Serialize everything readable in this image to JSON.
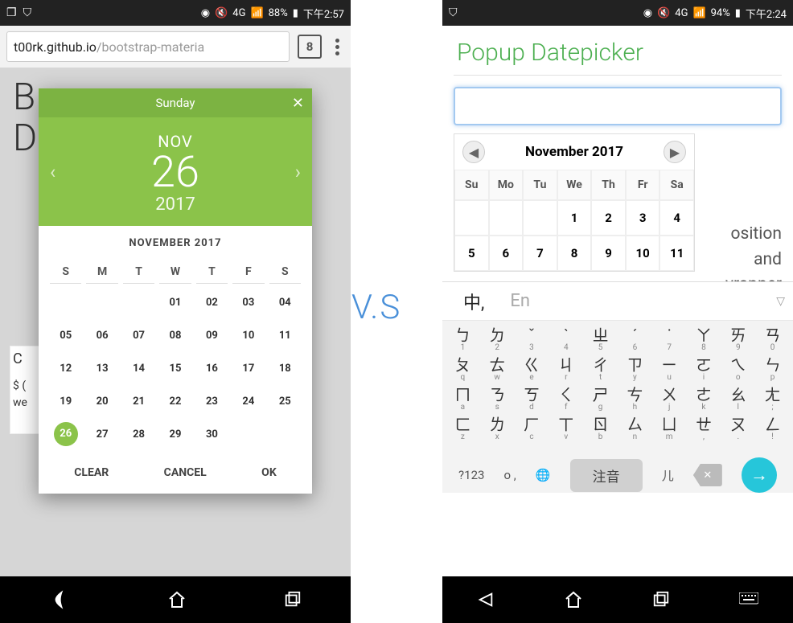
{
  "comparison_label": "V.S",
  "left": {
    "statusbar": {
      "battery": "88%",
      "time": "下午2:57",
      "net": "4G"
    },
    "url_dark": "t00rk.github.io",
    "url_light": "/bootstrap-materia",
    "tab_count": "8",
    "bg_B": "B",
    "bg_D": "D",
    "bg_card_c": "C",
    "bg_card_l1": "$ (",
    "bg_card_l2": "we",
    "dp": {
      "weekday": "Sunday",
      "month_abbr": "NOV",
      "day": "26",
      "year": "2017",
      "title": "NOVEMBER 2017",
      "dow": [
        "S",
        "M",
        "T",
        "W",
        "T",
        "F",
        "S"
      ],
      "weeks": [
        [
          "",
          "",
          "",
          "",
          "01",
          "02",
          "03",
          "04"
        ],
        [
          "05",
          "06",
          "07",
          "08",
          "09",
          "10",
          "11"
        ],
        [
          "12",
          "13",
          "14",
          "15",
          "16",
          "17",
          "18"
        ],
        [
          "19",
          "20",
          "21",
          "22",
          "23",
          "24",
          "25"
        ],
        [
          "26",
          "27",
          "28",
          "29",
          "30",
          "",
          ""
        ]
      ],
      "selected": "26",
      "clear": "CLEAR",
      "cancel": "CANCEL",
      "ok": "OK"
    }
  },
  "right": {
    "statusbar": {
      "battery": "94%",
      "time": "下午2:24",
      "net": "4G"
    },
    "title": "Popup Datepicker",
    "cal": {
      "title": "November 2017",
      "dow": [
        "Su",
        "Mo",
        "Tu",
        "We",
        "Th",
        "Fr",
        "Sa"
      ],
      "rows": [
        [
          "",
          "",
          "",
          "1",
          "2",
          "3",
          "4"
        ],
        [
          "5",
          "6",
          "7",
          "8",
          "9",
          "10",
          "11"
        ]
      ]
    },
    "bg_text": [
      "osition",
      "and",
      "vrapper"
    ],
    "ime": {
      "tab_zh": "中,",
      "tab_en": "En",
      "rows": [
        {
          "syms": [
            "ㄅ",
            "ㄉ",
            "ˇ",
            "ˋ",
            "ㄓ",
            "ˊ",
            "˙",
            "ㄚ",
            "ㄞ",
            "ㄢ"
          ],
          "subs": [
            "1",
            "2",
            "3",
            "4",
            "5",
            "6",
            "7",
            "8",
            "9",
            "0"
          ]
        },
        {
          "syms": [
            "ㄆ",
            "ㄊ",
            "ㄍ",
            "ㄐ",
            "ㄔ",
            "ㄗ",
            "ㄧ",
            "ㄛ",
            "ㄟ",
            "ㄣ"
          ],
          "subs": [
            "q",
            "w",
            "e",
            "r",
            "t",
            "y",
            "u",
            "i",
            "o",
            "p"
          ]
        },
        {
          "syms": [
            "ㄇ",
            "ㄋ",
            "ㄎ",
            "ㄑ",
            "ㄕ",
            "ㄘ",
            "ㄨ",
            "ㄜ",
            "ㄠ",
            "ㄤ"
          ],
          "subs": [
            "a",
            "s",
            "d",
            "f",
            "g",
            "h",
            "j",
            "k",
            "l",
            ";"
          ]
        },
        {
          "syms": [
            "ㄈ",
            "ㄌ",
            "ㄏ",
            "ㄒ",
            "ㄖ",
            "ㄙ",
            "ㄩ",
            "ㄝ",
            "ㄡ",
            "ㄥ"
          ],
          "subs": [
            "z",
            "x",
            "c",
            "v",
            "b",
            "n",
            "m",
            ",",
            ".",
            "!"
          ]
        }
      ],
      "numkey": "?123",
      "comma": "o ,",
      "space": "注音",
      "er": "儿"
    }
  }
}
